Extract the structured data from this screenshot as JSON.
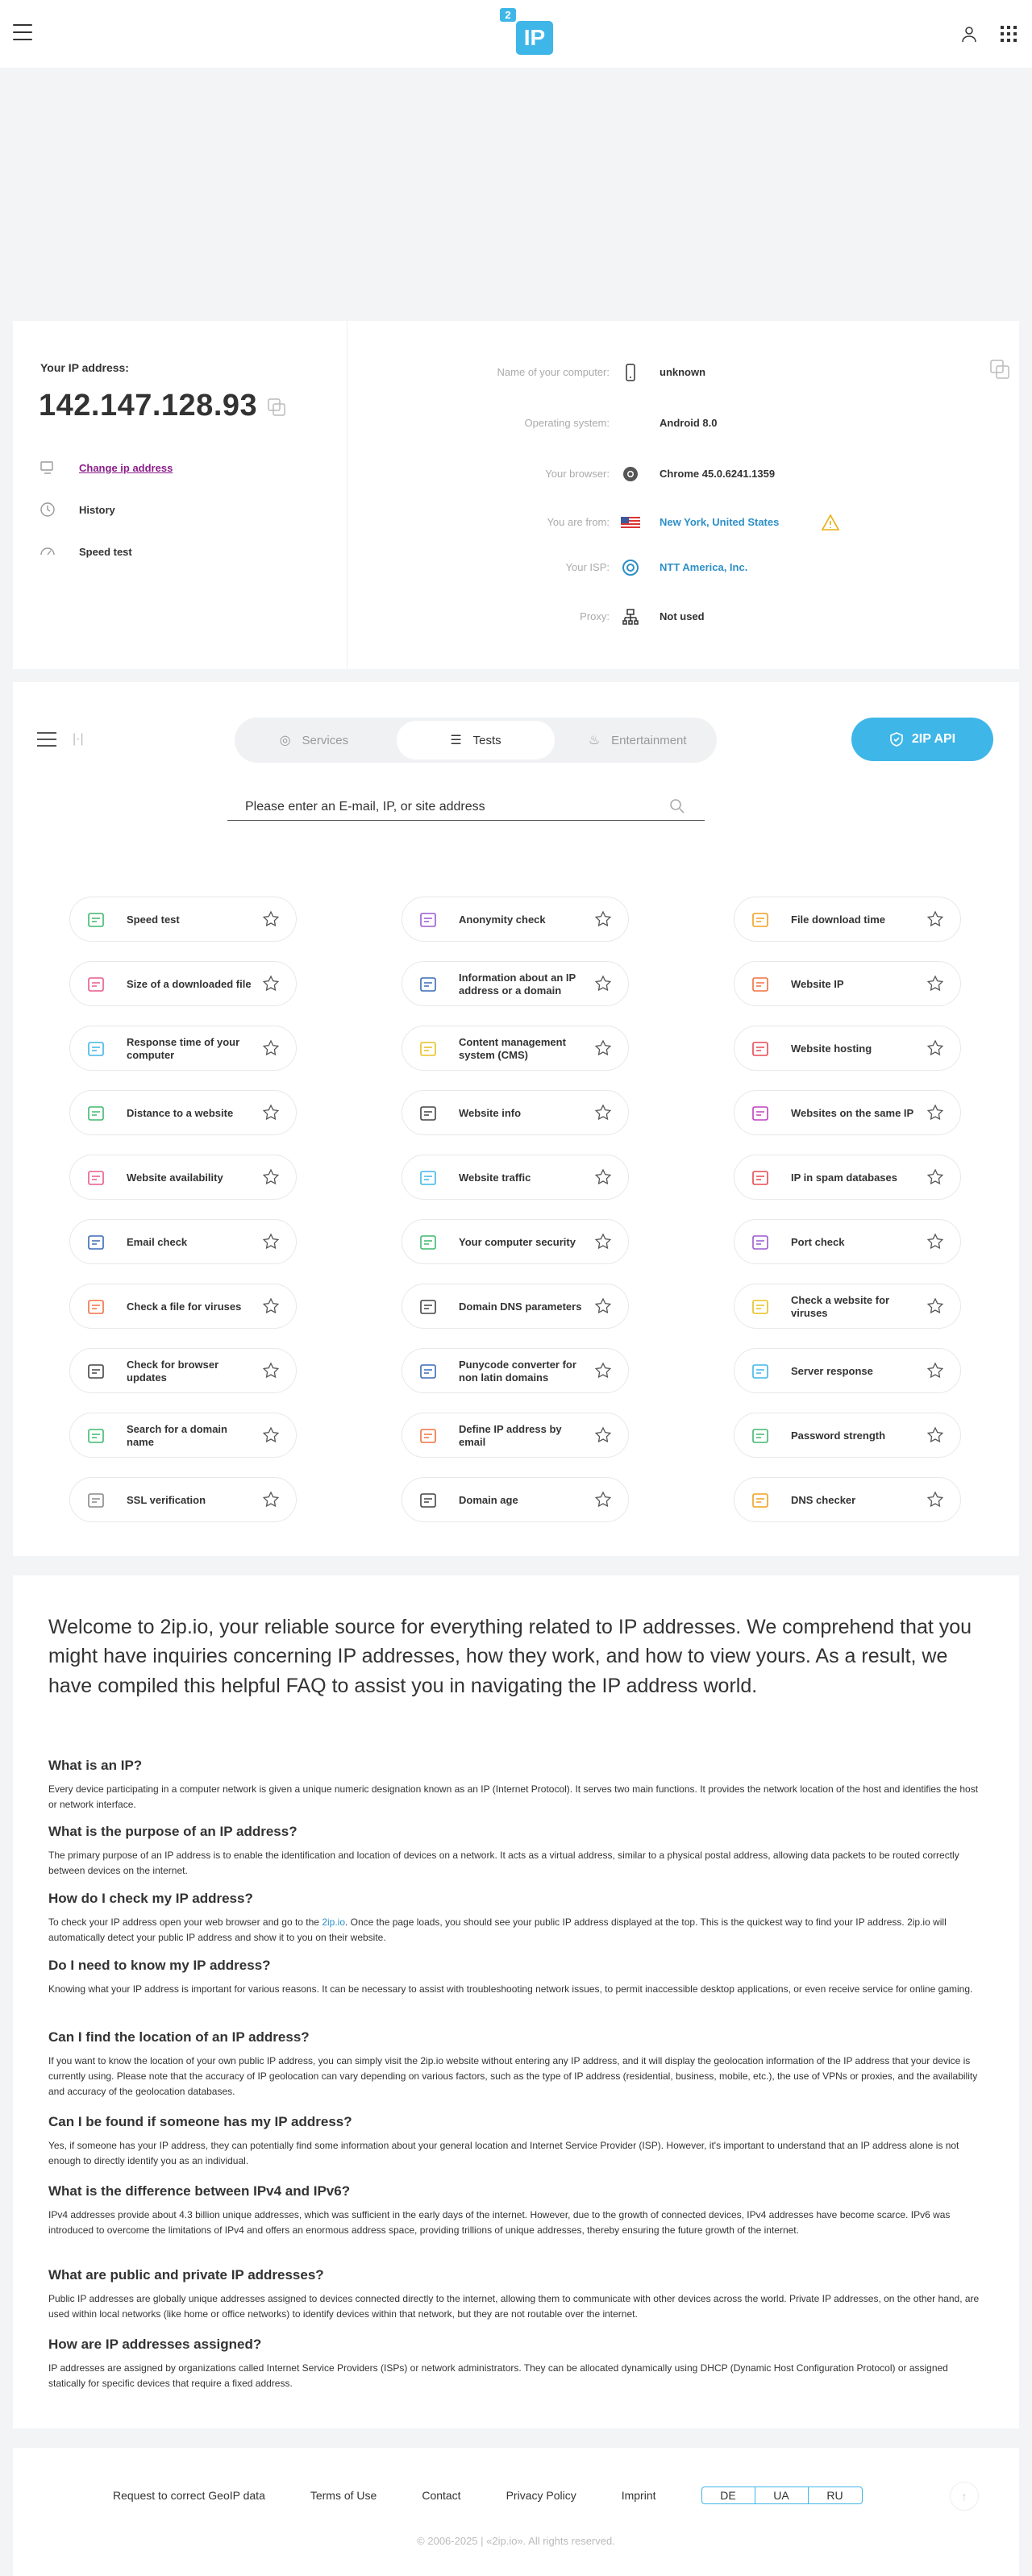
{
  "header": {
    "logo_badge": "2",
    "logo_main": "IP"
  },
  "ip_info": {
    "label": "Your IP address:",
    "value": "142.147.128.93",
    "actions": [
      {
        "label": "Change ip address",
        "icon": "change-ip-icon"
      },
      {
        "label": "History",
        "icon": "history-icon"
      },
      {
        "label": "Speed test",
        "icon": "speed-icon"
      }
    ],
    "rows": [
      {
        "label": "Name of your computer:",
        "value": "unknown",
        "icon": "phone-icon"
      },
      {
        "label": "Operating system:",
        "value": "Android 8.0",
        "icon": "android-icon"
      },
      {
        "label": "Your browser:",
        "value": "Chrome 45.0.6241.1359",
        "icon": "chrome-icon"
      },
      {
        "label": "You are from:",
        "value": "New York, United States",
        "icon": "us-flag-icon"
      },
      {
        "label": "Your ISP:",
        "value": "NTT America, Inc.",
        "icon": "isp-icon"
      },
      {
        "label": "Proxy:",
        "value": "Not used",
        "icon": "proxy-icon"
      }
    ]
  },
  "tools_section": {
    "tabs": [
      {
        "label": "Services"
      },
      {
        "label": "Tests"
      },
      {
        "label": "Entertainment"
      }
    ],
    "api_label": "2IP API",
    "search_placeholder": "Please enter an E-mail, IP, or site address",
    "tools": [
      {
        "label": "Speed test",
        "color": "#3fb96e"
      },
      {
        "label": "Anonymity check",
        "color": "#9b59d0"
      },
      {
        "label": "File download time",
        "color": "#f0a020"
      },
      {
        "label": "Size of a downloaded file",
        "color": "#e85a8a"
      },
      {
        "label": "Information about an IP address or a domain",
        "color": "#3a6ab8"
      },
      {
        "label": "Website IP",
        "color": "#f07040"
      },
      {
        "label": "Response time of your computer",
        "color": "#3fb6e8"
      },
      {
        "label": "Content management system (CMS)",
        "color": "#e8c020"
      },
      {
        "label": "Website hosting",
        "color": "#e84850"
      },
      {
        "label": "Distance to a website",
        "color": "#3fb96e"
      },
      {
        "label": "Website info",
        "color": "#444444"
      },
      {
        "label": "Websites on the same IP",
        "color": "#c040c0"
      },
      {
        "label": "Website availability",
        "color": "#e85a8a"
      },
      {
        "label": "Website traffic",
        "color": "#3fb6e8"
      },
      {
        "label": "IP in spam databases",
        "color": "#e84850"
      },
      {
        "label": "Email check",
        "color": "#3a6ab8"
      },
      {
        "label": "Your computer security",
        "color": "#3fb96e"
      },
      {
        "label": "Port check",
        "color": "#9b59d0"
      },
      {
        "label": "Check a file for viruses",
        "color": "#f07040"
      },
      {
        "label": "Domain DNS parameters",
        "color": "#444444"
      },
      {
        "label": "Check a website for viruses",
        "color": "#e8c020"
      },
      {
        "label": "Check for browser updates",
        "color": "#444444"
      },
      {
        "label": "Punycode converter for non latin domains",
        "color": "#3a6ab8"
      },
      {
        "label": "Server response",
        "color": "#3fb6e8"
      },
      {
        "label": "Search for a domain name",
        "color": "#3fb96e"
      },
      {
        "label": "Define IP address by email",
        "color": "#f07040"
      },
      {
        "label": "Password strength",
        "color": "#3fb96e"
      },
      {
        "label": "SSL verification",
        "color": "#888888"
      },
      {
        "label": "Domain age",
        "color": "#444444"
      },
      {
        "label": "DNS checker",
        "color": "#f0a020"
      }
    ]
  },
  "faq": {
    "intro": "Welcome to 2ip.io, your reliable source for everything related to IP addresses. We comprehend that you might have inquiries concerning IP addresses, how they work, and how to view yours. As a result, we have compiled this helpful FAQ to assist you in navigating the IP address world.",
    "items": [
      {
        "q": "What is an IP?",
        "a": "Every device participating in a computer network is given a unique numeric designation known as an IP (Internet Protocol). It serves two main functions. It provides the network location of the host and identifies the host or network interface."
      },
      {
        "q": "What is the purpose of an IP address?",
        "a": "The primary purpose of an IP address is to enable the identification and location of devices on a network. It acts as a virtual address, similar to a physical postal address, allowing data packets to be routed correctly between devices on the internet."
      },
      {
        "q": "How do I check my IP address?",
        "a_pre": "To check your IP address open your web browser and go to the ",
        "a_link": "2ip.io",
        "a_post": ". Once the page loads, you should see your public IP address displayed at the top. This is the quickest way to find your IP address. 2ip.io will automatically detect your public IP address and show it to you on their website."
      },
      {
        "q": "Do I need to know my IP address?",
        "a": "Knowing what your IP address is important for various reasons. It can be necessary to assist with troubleshooting network issues, to permit inaccessible desktop applications, or even receive service for online gaming."
      },
      {
        "q": "Can I find the location of an IP address?",
        "a": "If you want to know the location of your own public IP address, you can simply visit the 2ip.io website without entering any IP address, and it will display the geolocation information of the IP address that your device is currently using. Please note that the accuracy of IP geolocation can vary depending on various factors, such as the type of IP address (residential, business, mobile, etc.), the use of VPNs or proxies, and the availability and accuracy of the geolocation databases."
      },
      {
        "q": "Can I be found if someone has my IP address?",
        "a": "Yes, if someone has your IP address, they can potentially find some information about your general location and Internet Service Provider (ISP). However, it's important to understand that an IP address alone is not enough to directly identify you as an individual."
      },
      {
        "q": "What is the difference between IPv4 and IPv6?",
        "a": "IPv4 addresses provide about 4.3 billion unique addresses, which was sufficient in the early days of the internet. However, due to the growth of connected devices, IPv4 addresses have become scarce. IPv6 was introduced to overcome the limitations of IPv4 and offers an enormous address space, providing trillions of unique addresses, thereby ensuring the future growth of the internet."
      },
      {
        "q": "What are public and private IP addresses?",
        "a": "Public IP addresses are globally unique addresses assigned to devices connected directly to the internet, allowing them to communicate with other devices across the world. Private IP addresses, on the other hand, are used within local networks (like home or office networks) to identify devices within that network, but they are not routable over the internet."
      },
      {
        "q": "How are IP addresses assigned?",
        "a": "IP addresses are assigned by organizations called Internet Service Providers (ISPs) or network administrators. They can be allocated dynamically using DHCP (Dynamic Host Configuration Protocol) or assigned statically for specific devices that require a fixed address."
      }
    ]
  },
  "footer": {
    "links": [
      "Request to correct GeoIP data",
      "Terms of Use",
      "Contact",
      "Privacy Policy",
      "Imprint"
    ],
    "langs": [
      "DE",
      "UA",
      "RU"
    ],
    "copyright": "© 2006-2025 | «2ip.io». All rights reserved."
  }
}
